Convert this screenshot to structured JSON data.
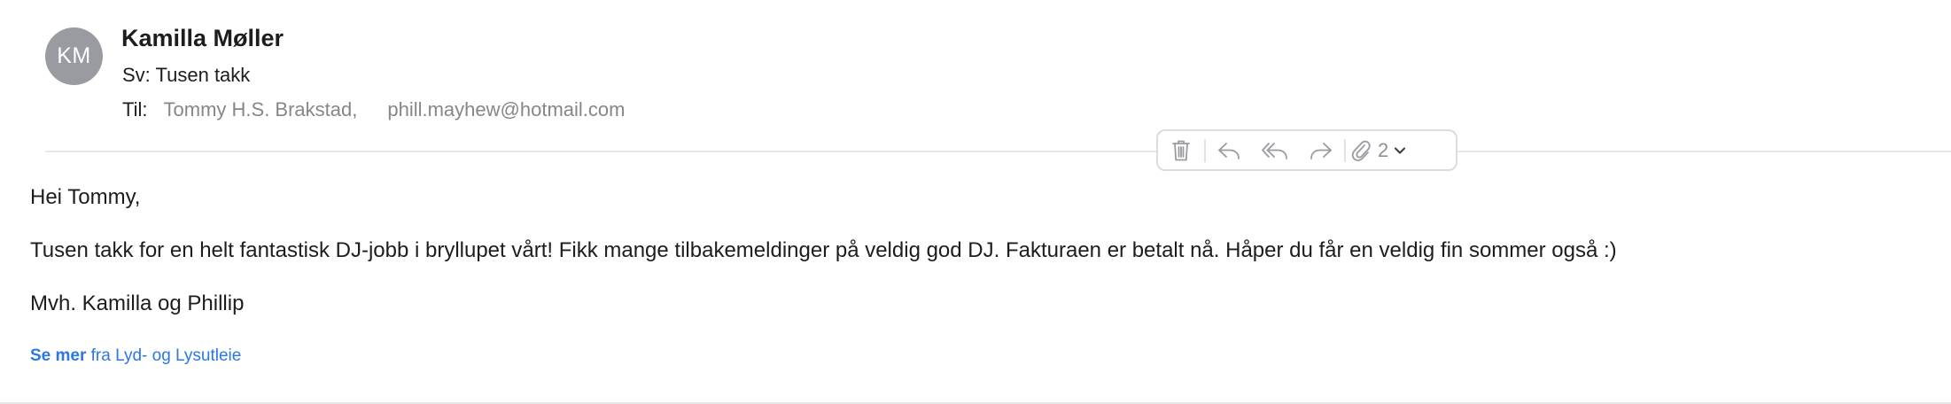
{
  "message": {
    "avatar_initials": "KM",
    "sender_name": "Kamilla Møller",
    "subject": "Sv: Tusen takk",
    "to_label": "Til:",
    "recipients": [
      "Tommy H.S. Brakstad,",
      "phill.mayhew@hotmail.com"
    ]
  },
  "toolbar": {
    "attachment_count": "2",
    "icons": [
      "trash-icon",
      "reply-icon",
      "reply-all-icon",
      "forward-icon",
      "paperclip-icon",
      "chevron-down-icon"
    ]
  },
  "body": {
    "greeting": "Hei Tommy,",
    "paragraph": "Tusen takk for en helt fantastisk DJ-jobb i bryllupet vårt! Fikk mange tilbakemeldinger på veldig god DJ. Fakturaen er betalt nå. Håper du får en veldig fin sommer også :)",
    "signoff": "Mvh. Kamilla og Phillip"
  },
  "footer": {
    "see_more_bold": "Se mer",
    "see_more_rest": "fra Lyd- og Lysutleie"
  },
  "colors": {
    "avatar": "#9a9ba0",
    "link": "#2b77e6",
    "secondary_text": "#86868b"
  }
}
